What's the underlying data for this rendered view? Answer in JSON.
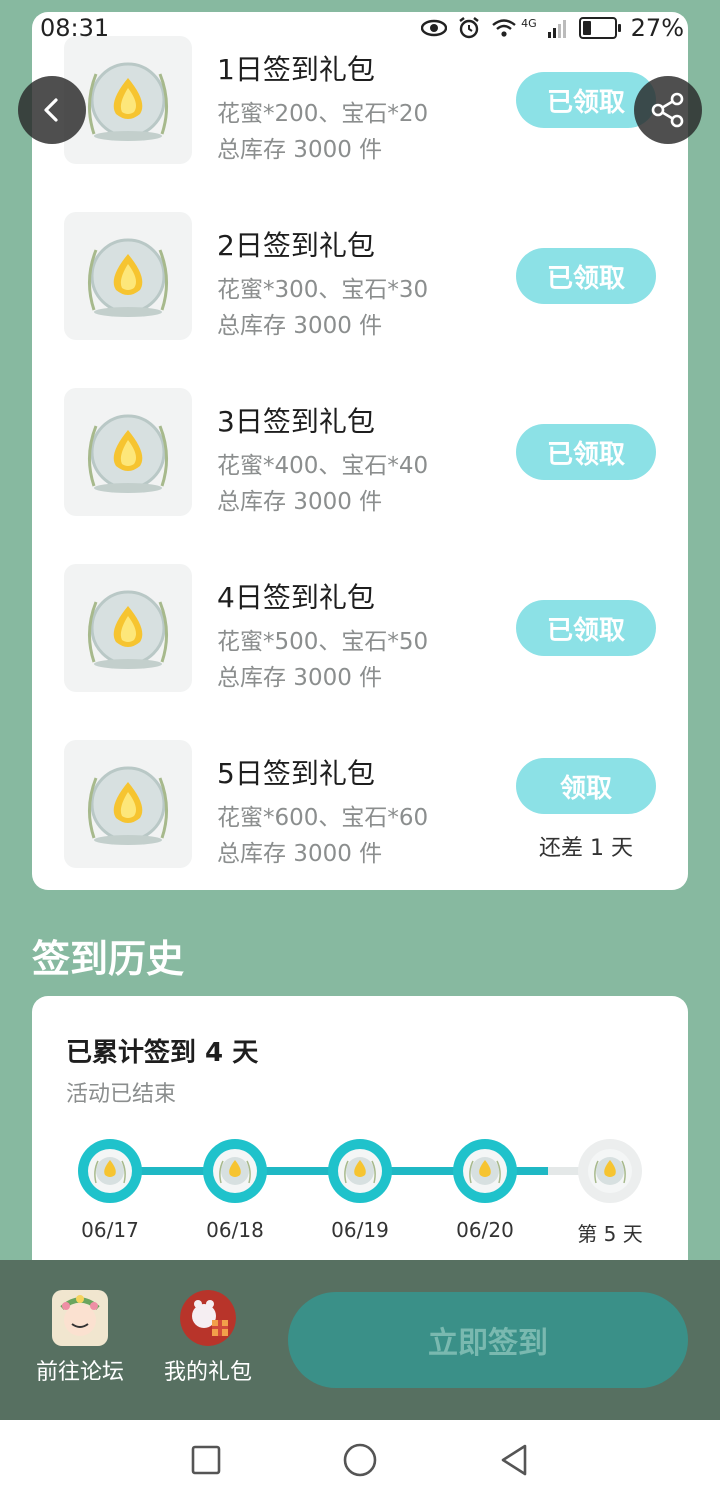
{
  "status_bar": {
    "time": "08:31",
    "icons": [
      "eye-icon",
      "alarm-icon",
      "wifi-icon",
      "signal-icon",
      "battery-icon"
    ],
    "network_label": "4G",
    "battery_percent": "27%"
  },
  "nav": {
    "back_icon": "chevron-left-icon",
    "share_icon": "share-icon"
  },
  "gifts": [
    {
      "title": "1日签到礼包",
      "rewards": "花蜜*200、宝石*20",
      "stock": "总库存 3000 件",
      "button": "已领取",
      "note": ""
    },
    {
      "title": "2日签到礼包",
      "rewards": "花蜜*300、宝石*30",
      "stock": "总库存 3000 件",
      "button": "已领取",
      "note": ""
    },
    {
      "title": "3日签到礼包",
      "rewards": "花蜜*400、宝石*40",
      "stock": "总库存 3000 件",
      "button": "已领取",
      "note": ""
    },
    {
      "title": "4日签到礼包",
      "rewards": "花蜜*500、宝石*50",
      "stock": "总库存 3000 件",
      "button": "已领取",
      "note": ""
    },
    {
      "title": "5日签到礼包",
      "rewards": "花蜜*600、宝石*60",
      "stock": "总库存 3000 件",
      "button": "领取",
      "note": "还差 1 天"
    }
  ],
  "history": {
    "title": "签到历史",
    "count_text": "已累计签到 4 天",
    "status_text": "活动已结束",
    "days": [
      {
        "label": "06/17",
        "done": true
      },
      {
        "label": "06/18",
        "done": true
      },
      {
        "label": "06/19",
        "done": true
      },
      {
        "label": "06/20",
        "done": true
      },
      {
        "label": "第 5 天",
        "done": false
      }
    ]
  },
  "bottom_bar": {
    "forum_label": "前往论坛",
    "gifts_label": "我的礼包",
    "checkin_label": "立即签到"
  },
  "colors": {
    "background": "#87b9a0",
    "claim_button": "#8ce1e6",
    "progress": "#1fb8c4",
    "bottom_bar": "#577061",
    "checkin_button": "#3a9088"
  }
}
